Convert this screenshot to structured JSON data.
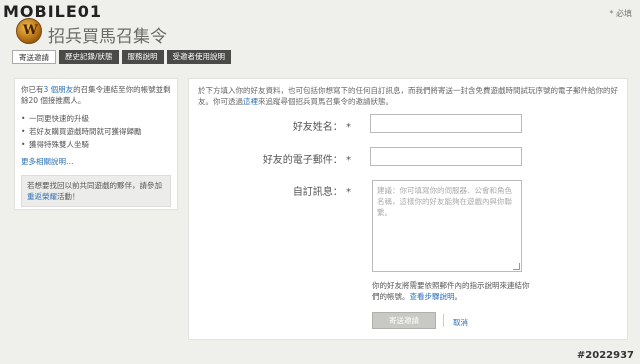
{
  "site": {
    "logo": "MOBILE01",
    "must_notice": "* 必填"
  },
  "header": {
    "title": "招兵買馬召集令"
  },
  "tabs": [
    "寄送邀請",
    "歷史記錄/狀態",
    "服務說明",
    "受邀者使用說明"
  ],
  "sidebar": {
    "intro_pre": "你已有",
    "intro_link": "3 個朋友",
    "intro_post": "的召集令連結至你的帳號並剩餘20 個接推薦人。",
    "items": [
      "一同更快速的升級",
      "若好友購買遊戲時間就可獲得歸勵",
      "獲得特殊雙人坐騎"
    ],
    "more_link": "更多相關說明…",
    "recruit_pre": "若想要找回以前共同遊戲的夥伴，請參加",
    "recruit_link": "重返榮耀",
    "recruit_post": "活動！"
  },
  "form": {
    "intro_pre": "於下方填入你的好友資料，也可包括你想寫下的任何自訂訊息，而我們將寄送一封含免費遊戲時間試玩序號的電子郵件給你的好友。你可透過",
    "intro_link": "這裡",
    "intro_post": "來追蹤尋個招兵買馬召集令的邀請狀態。",
    "name_label": "好友姓名：",
    "email_label": "好友的電子郵件：",
    "message_label": "自訂訊息：",
    "required_mark": "*",
    "message_placeholder": "建議：你可填寫你的伺服器、公會和角色名稱，這樣你的好友能夠在遊戲內與你聯繫。",
    "note_pre": "你的好友將需要依照郵件內的指示說明來連結你們的帳號。",
    "note_link": "查看步驟說明",
    "note_post": "。",
    "send_button": "寄送邀請",
    "cancel_link": "取消"
  },
  "watermark": "#2022937"
}
